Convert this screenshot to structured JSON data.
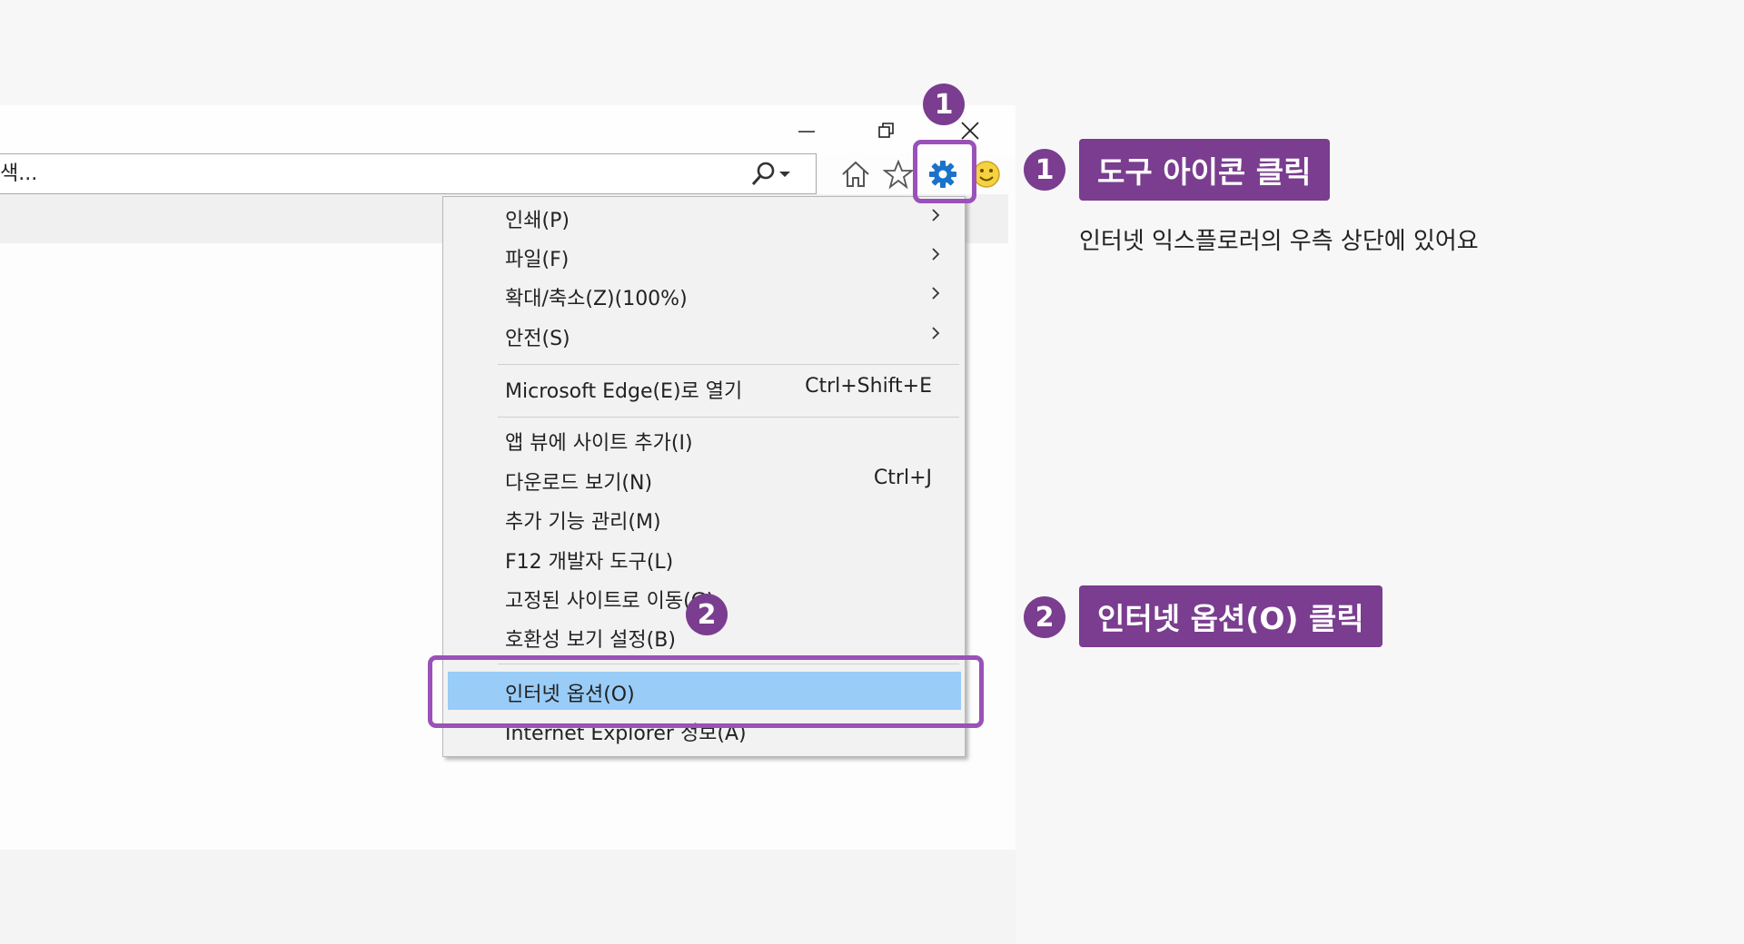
{
  "address_bar": {
    "placeholder": "색..."
  },
  "menu": {
    "items": [
      {
        "label": "인쇄(P)",
        "shortcut": "",
        "submenu": true
      },
      {
        "label": "파일(F)",
        "shortcut": "",
        "submenu": true
      },
      {
        "label": "확대/축소(Z)(100%)",
        "shortcut": "",
        "submenu": true
      },
      {
        "label": "안전(S)",
        "shortcut": "",
        "submenu": true
      },
      {
        "label": "Microsoft Edge(E)로 열기",
        "shortcut": "Ctrl+Shift+E",
        "submenu": false
      },
      {
        "label": "앱 뷰에 사이트 추가(I)",
        "shortcut": "",
        "submenu": false
      },
      {
        "label": "다운로드 보기(N)",
        "shortcut": "Ctrl+J",
        "submenu": false
      },
      {
        "label": "추가 기능 관리(M)",
        "shortcut": "",
        "submenu": false
      },
      {
        "label": "F12 개발자 도구(L)",
        "shortcut": "",
        "submenu": false
      },
      {
        "label": "고정된 사이트로 이동(G)",
        "shortcut": "",
        "submenu": false
      },
      {
        "label": "호환성 보기 설정(B)",
        "shortcut": "",
        "submenu": false
      },
      {
        "label": "인터넷 옵션(O)",
        "shortcut": "",
        "submenu": false,
        "highlighted": true
      },
      {
        "label": "Internet Explorer 정보(A)",
        "shortcut": "",
        "submenu": false
      }
    ]
  },
  "annotations": {
    "step1": {
      "number": "1",
      "label": "도구 아이콘 클릭",
      "description": "인터넷 익스플로러의 우측 상단에 있어요"
    },
    "step2": {
      "number": "2",
      "label": "인터넷 옵션(O) 클릭"
    }
  },
  "colors": {
    "accent": "#7a3d8f",
    "highlight_border": "#9a51b8",
    "menu_highlight": "#99ccf7",
    "gear_icon": "#1a73c8"
  },
  "icons": [
    "minimize-icon",
    "restore-icon",
    "close-icon",
    "search-icon",
    "home-icon",
    "favorites-star-icon",
    "gear-icon",
    "smiley-feedback-icon",
    "chevron-right-icon"
  ]
}
